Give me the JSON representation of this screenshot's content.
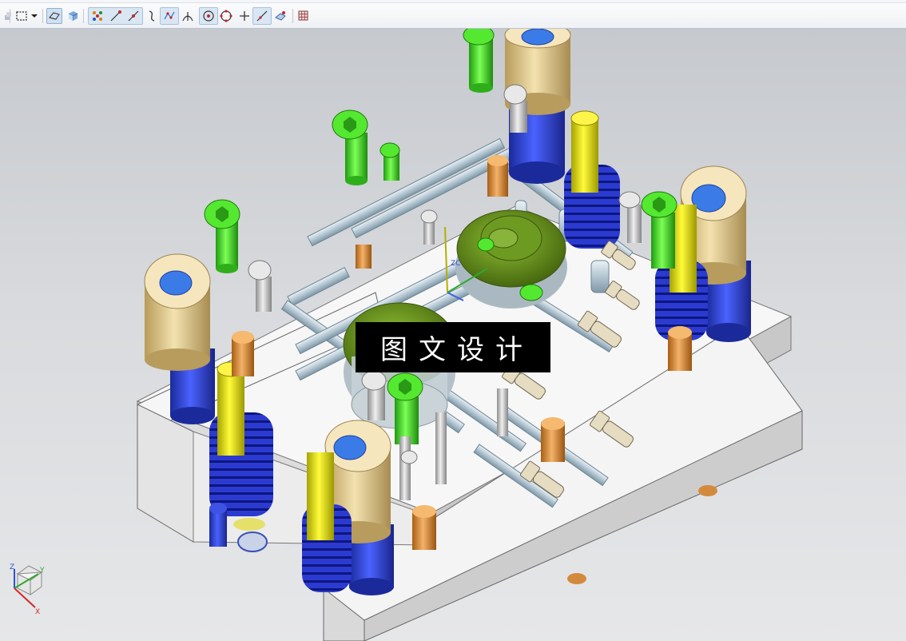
{
  "toolbar": {
    "icons": [
      {
        "name": "selection-filter-icon"
      },
      {
        "name": "rectangle-select-icon"
      },
      {
        "name": "dropdown-arrow-icon"
      },
      {
        "name": "wireframe-view-icon"
      },
      {
        "name": "shaded-view-icon"
      },
      {
        "name": "snap-all-points-icon"
      },
      {
        "name": "snap-endpoint-icon"
      },
      {
        "name": "snap-midpoint-icon"
      },
      {
        "name": "snap-curve-icon"
      },
      {
        "name": "snap-control-point-icon"
      },
      {
        "name": "snap-intersection-icon"
      },
      {
        "name": "snap-arc-center-icon"
      },
      {
        "name": "snap-quadrant-icon"
      },
      {
        "name": "snap-point-on-curve-icon"
      },
      {
        "name": "snap-point-on-line-icon"
      },
      {
        "name": "snap-point-on-face-icon"
      },
      {
        "name": "grid-icon"
      }
    ]
  },
  "viewport": {
    "watermark_text": "图文设计",
    "wcs_label": "ZC",
    "triad": {
      "x": "X",
      "y": "Y",
      "z": "Z"
    }
  },
  "colors": {
    "die_plate": "#f2f2f2",
    "tube": "#c6d4dc",
    "guide_bushing": "#e8d29a",
    "guide_post": "#2f3fbf",
    "screw_green": "#3cd21e",
    "spring_yellow": "#e4e00c",
    "pin_orange": "#e69a3a",
    "punch_olive": "#6f9a22"
  }
}
